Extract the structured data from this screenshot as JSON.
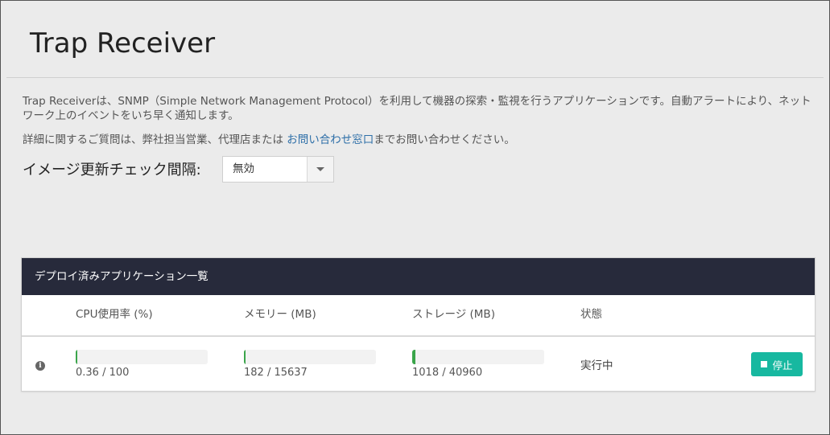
{
  "page": {
    "title": "Trap Receiver",
    "description": "Trap Receiverは、SNMP（Simple Network Management Protocol）を利用して機器の探索・監視を行うアプリケーションです。自動アラートにより、ネットワーク上のイベントをいち早く通知します。",
    "contact_prefix": "詳細に関するご質問は、弊社担当営業、代理店または ",
    "contact_link": "お問い合わせ窓口",
    "contact_suffix": "までお問い合わせください。"
  },
  "settings": {
    "image_check_label": "イメージ更新チェック間隔:",
    "image_check_value": "無効"
  },
  "deployed": {
    "header": "デプロイ済みアプリケーション一覧",
    "columns": {
      "cpu": "CPU使用率 (%)",
      "memory": "メモリー (MB)",
      "storage": "ストレージ (MB)",
      "status": "状態"
    },
    "rows": [
      {
        "cpu_text": "0.36 / 100",
        "cpu_fraction": 0.0036,
        "memory_text": "182 / 15637",
        "memory_fraction": 0.0116,
        "storage_text": "1018 / 40960",
        "storage_fraction": 0.0249,
        "status": "実行中",
        "action_label": "停止"
      }
    ]
  },
  "colors": {
    "header_bg": "#272a3b",
    "button_bg": "#17b8a0",
    "bar_fill": "#3aa54a",
    "link": "#2e6fa8"
  },
  "icons": {
    "info": "info-icon",
    "stop": "stop-icon",
    "dropdown": "caret-down-icon"
  }
}
